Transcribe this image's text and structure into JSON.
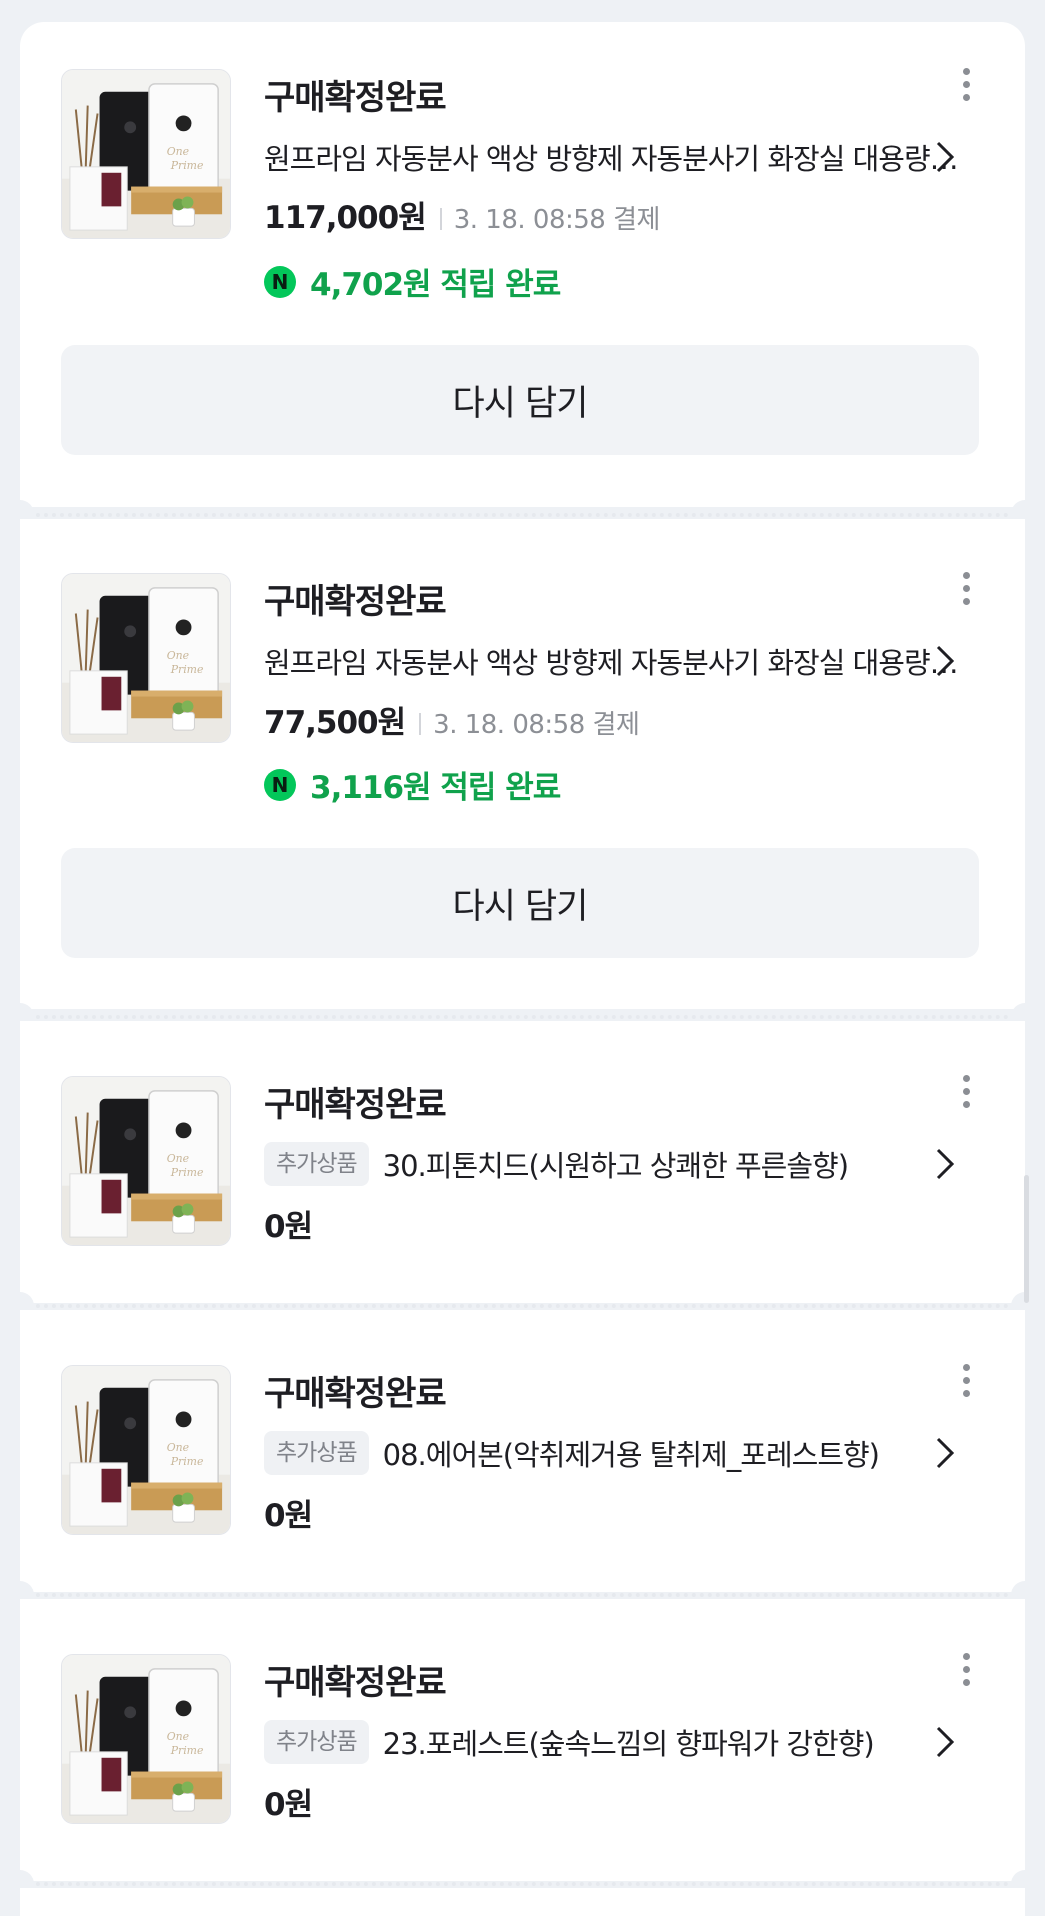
{
  "orders": [
    {
      "status": "구매확정완료",
      "badge": "",
      "title": "원프라임 자동분사 액상 방향제 자동분사기 화장실 대용량 디퓨저",
      "price": "117,000원",
      "date": "3. 18. 08:58 결제",
      "reward": "4,702원 적립 완료",
      "button": "다시 담기"
    },
    {
      "status": "구매확정완료",
      "badge": "",
      "title": "원프라임 자동분사 액상 방향제 자동분사기 화장실 대용량 디퓨저",
      "price": "77,500원",
      "date": "3. 18. 08:58 결제",
      "reward": "3,116원 적립 완료",
      "button": "다시 담기"
    },
    {
      "status": "구매확정완료",
      "badge": "추가상품",
      "title": "30.피톤치드(시원하고 상쾌한 푸른솔향)",
      "price": "0원"
    },
    {
      "status": "구매확정완료",
      "badge": "추가상품",
      "title": "08.에어본(악취제거용 탈취제_포레스트향)",
      "price": "0원"
    },
    {
      "status": "구매확정완료",
      "badge": "추가상품",
      "title": "23.포레스트(숲속느낌의 향파워가 강한향)",
      "price": "0원"
    }
  ],
  "icons": {
    "more": "more-vertical-icon",
    "chevron": "chevron-right-icon",
    "reward": "naver-pay-point-icon"
  },
  "colors": {
    "reward_green": "#10a24c",
    "npay_badge": "#03c75a",
    "button_bg": "#f1f3f6",
    "page_bg": "#eef1f5"
  }
}
